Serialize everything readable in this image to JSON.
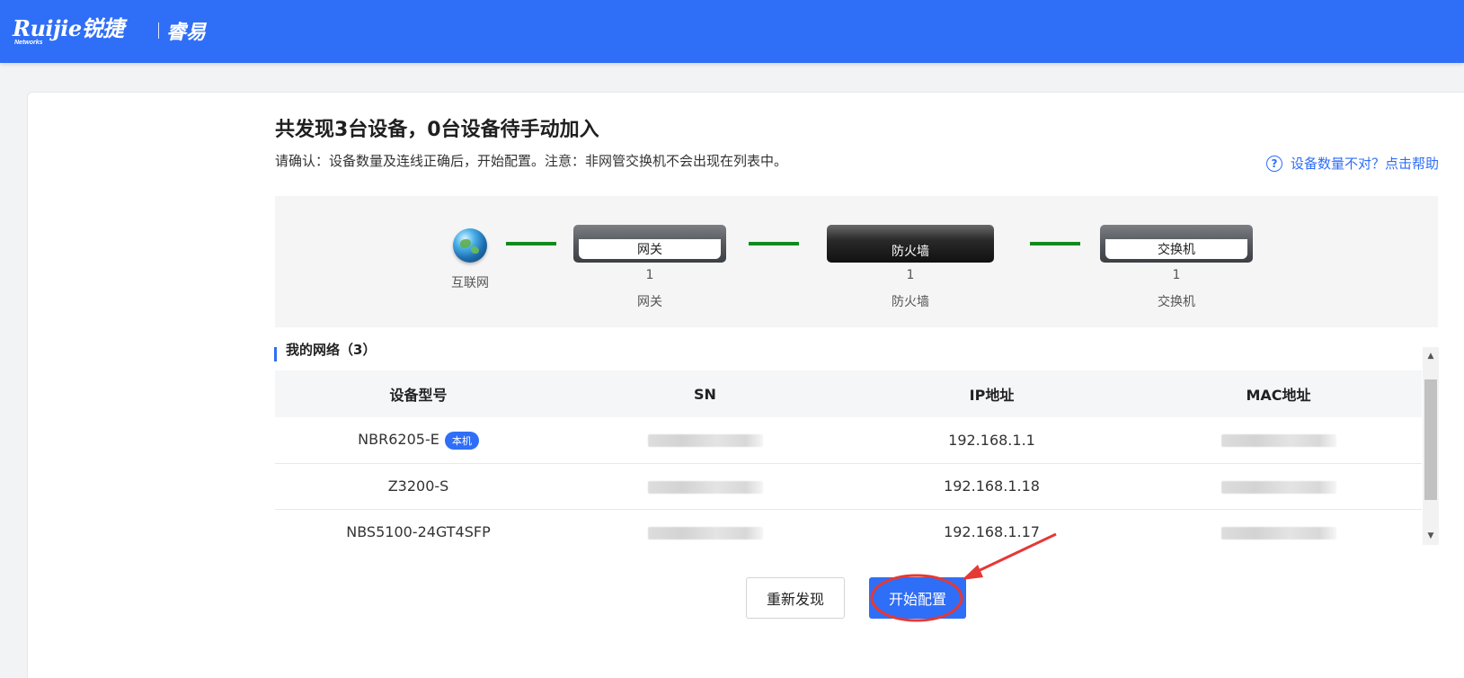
{
  "header": {
    "brand_main": "Ruijie锐捷",
    "brand_sub": "Networks",
    "product": "睿易"
  },
  "page": {
    "title": "共发现3台设备，0台设备待手动加入",
    "subtitle": "请确认：设备数量及连线正确后，开始配置。注意：非网管交换机不会出现在列表中。",
    "help_text": "设备数量不对？点击帮助",
    "help_icon": "question-circle-icon"
  },
  "topology": {
    "internet_label": "互联网",
    "gateway": {
      "face": "网关",
      "count": "1",
      "label": "网关"
    },
    "firewall": {
      "face": "防火墙",
      "count": "1",
      "label": "防火墙"
    },
    "switch": {
      "face": "交换机",
      "count": "1",
      "label": "交换机"
    },
    "link_color": "#118a1c"
  },
  "network": {
    "section_label": "我的网络（3）",
    "columns": [
      "设备型号",
      "SN",
      "IP地址",
      "MAC地址"
    ],
    "rows": [
      {
        "model": "NBR6205-E",
        "badge": "本机",
        "ip": "192.168.1.1"
      },
      {
        "model": "Z3200-S",
        "badge": "",
        "ip": "192.168.1.18"
      },
      {
        "model": "NBS5100-24GT4SFP",
        "badge": "",
        "ip": "192.168.1.17"
      }
    ]
  },
  "actions": {
    "rescan": "重新发现",
    "start": "开始配置"
  },
  "colors": {
    "brand": "#2f6ef7",
    "annotation": "#e53935"
  }
}
